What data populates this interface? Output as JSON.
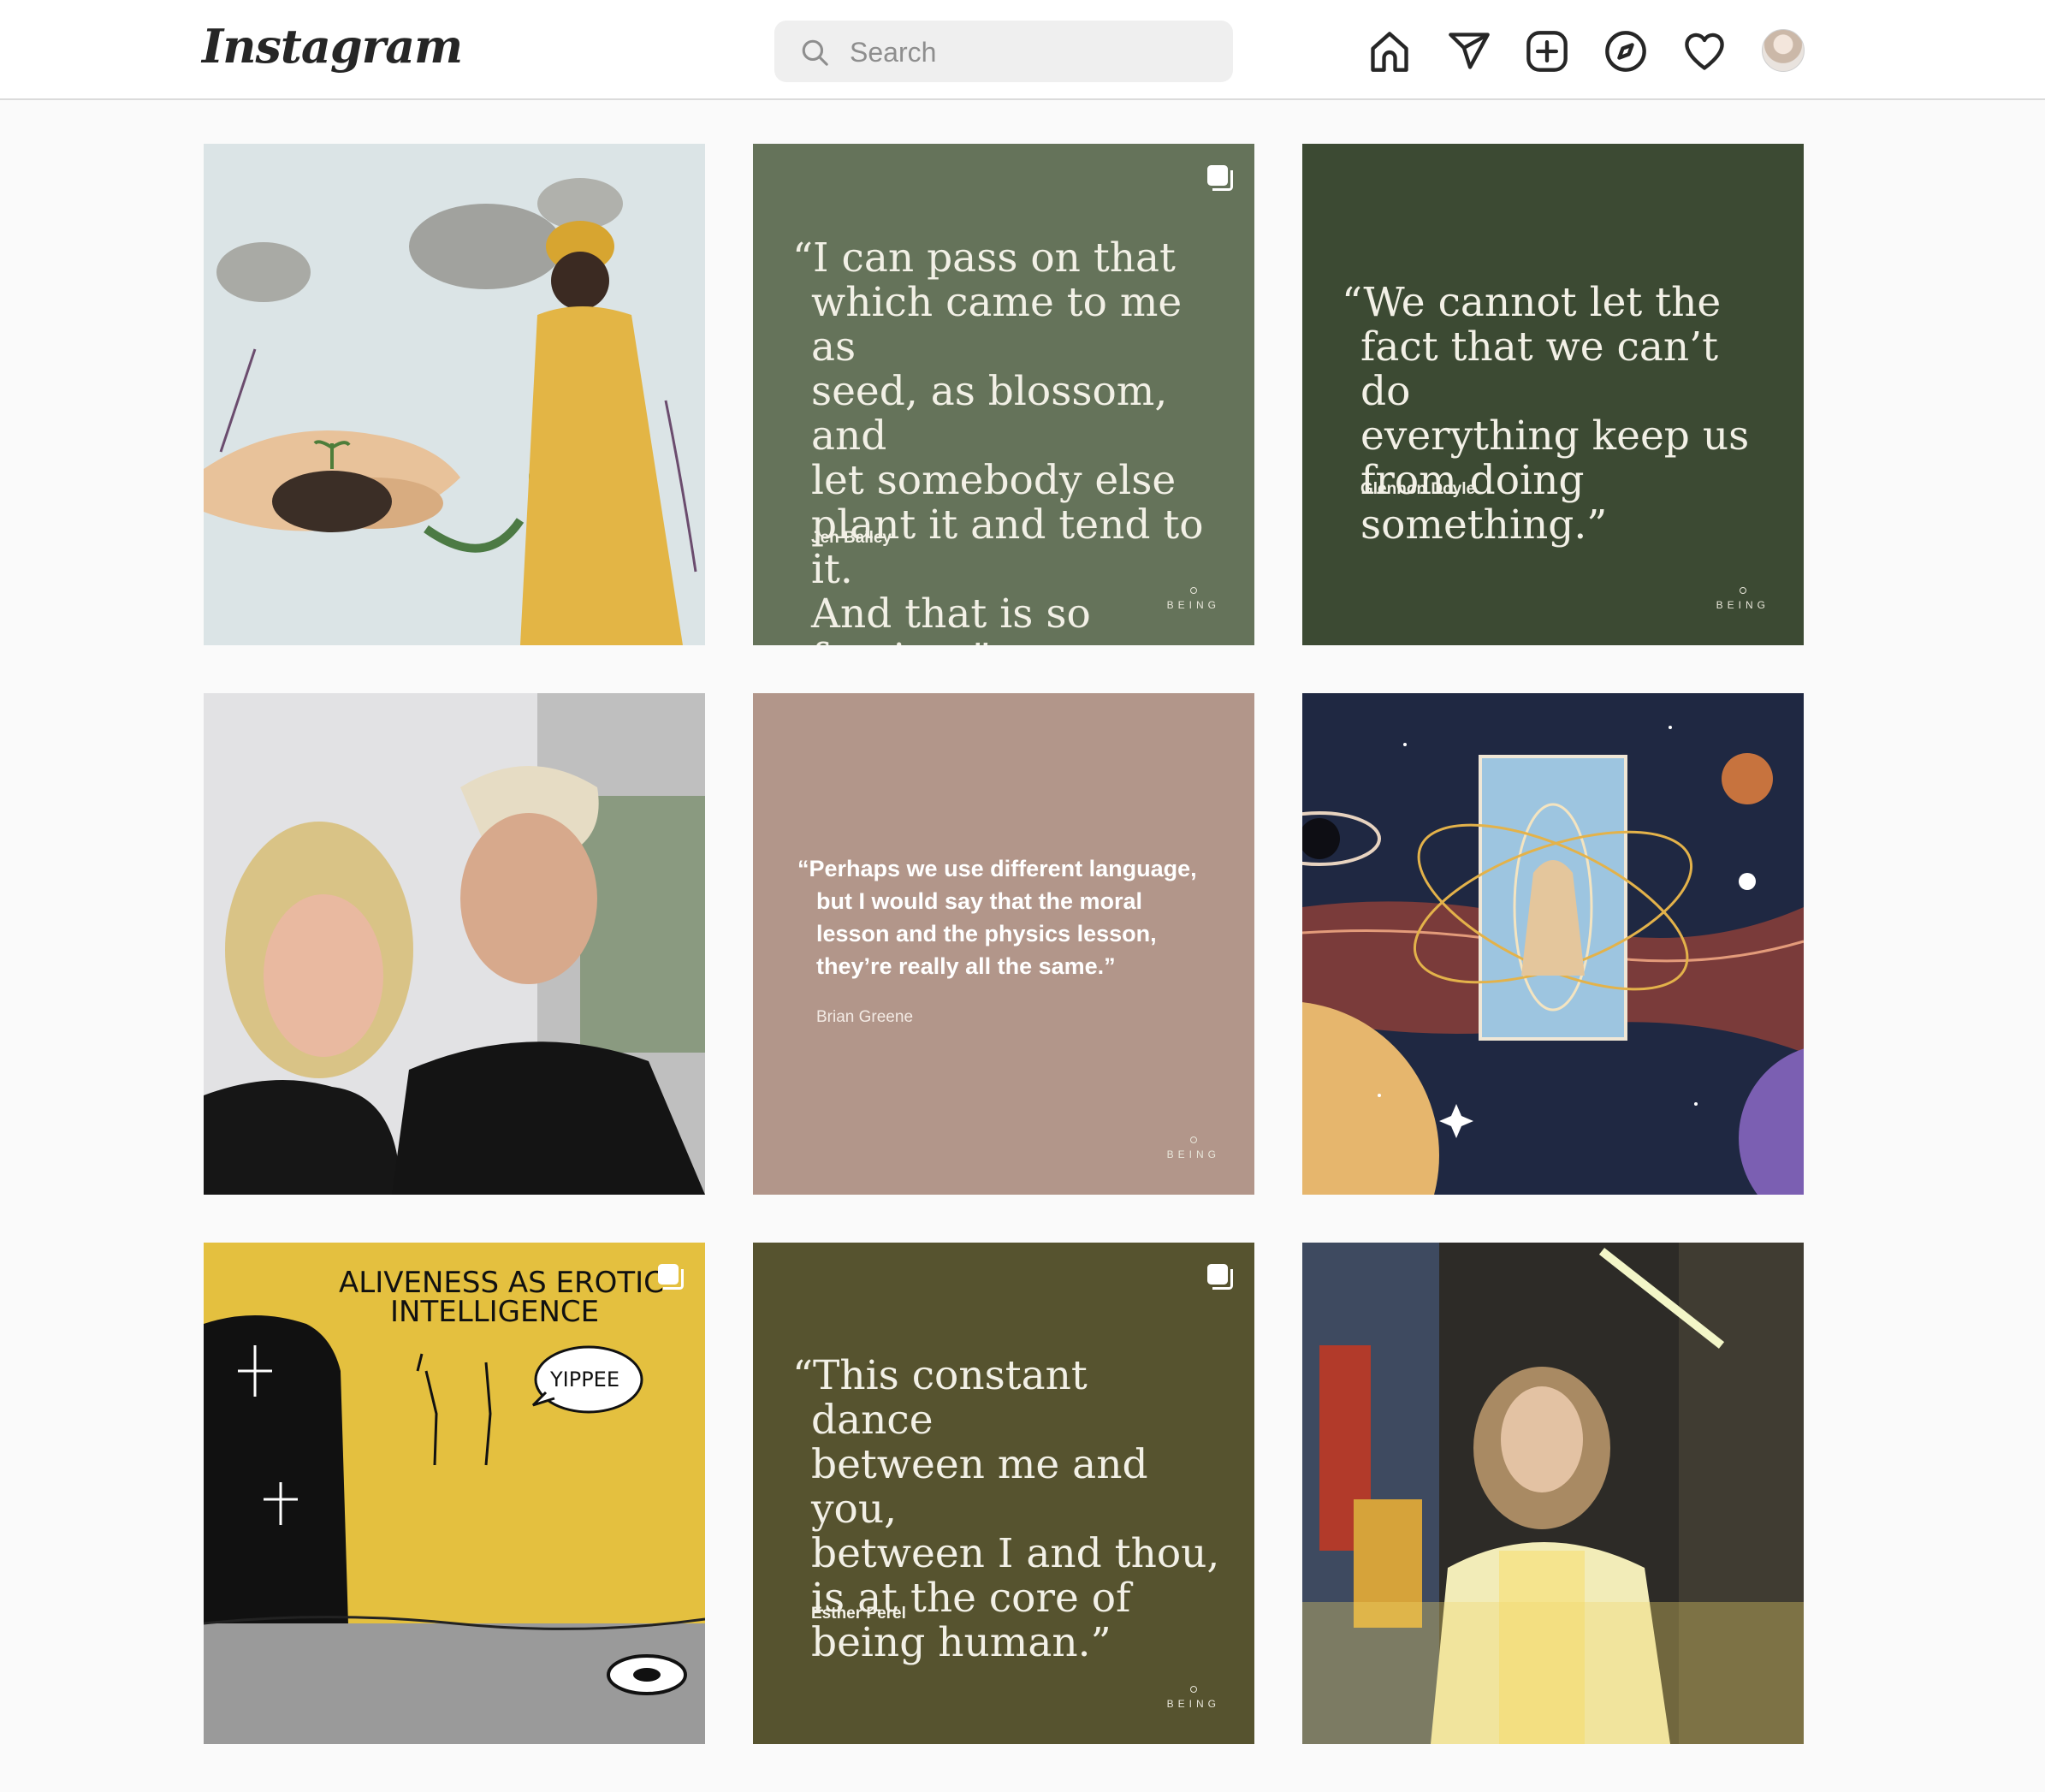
{
  "app": {
    "logo_text": "Instagram"
  },
  "search": {
    "placeholder": "Search"
  },
  "nav": {
    "icons": [
      "home-icon",
      "direct-message-icon",
      "new-post-icon",
      "explore-icon",
      "activity-heart-icon",
      "profile-avatar"
    ]
  },
  "colors": {
    "tile_green_sage": "#65735a",
    "tile_green_dark": "#3c4a33",
    "tile_mauve": "#b2968a",
    "tile_olive": "#56532f",
    "quote_text": "#f2f0e6"
  },
  "posts": {
    "p1": {
      "kind": "illustration",
      "description_icon": "hands-planting-illustration"
    },
    "p2": {
      "quote": "“I can pass on that\nwhich came to me as\nseed, as blossom, and\nlet somebody else\nplant it and tend to it.\nAnd that is so freeing.”",
      "author": "Jen Bailey",
      "brand": "BEING"
    },
    "p3": {
      "quote": "“We cannot let the\nfact that we can’t do\neverything keep us\nfrom doing something.”",
      "author": "Glennon Doyle",
      "brand": "BEING"
    },
    "p4": {
      "kind": "photo"
    },
    "p5": {
      "quote": "“Perhaps we use different language,\nbut I would say that the moral\nlesson and the physics lesson,\nthey’re really all the same.”",
      "author": "Brian Greene",
      "brand": "BEING"
    },
    "p6": {
      "kind": "illustration"
    },
    "p7": {
      "kind": "illustration",
      "title_line1": "ALIVENESS AS EROTIC",
      "title_line2": "INTELLIGENCE",
      "bubble": "YIPPEE"
    },
    "p8": {
      "quote": "“This constant dance\nbetween me and you,\nbetween I and thou,\nis at the core of\nbeing human.”",
      "author": "Esther Perel",
      "brand": "BEING"
    },
    "p9": {
      "kind": "photo"
    }
  }
}
